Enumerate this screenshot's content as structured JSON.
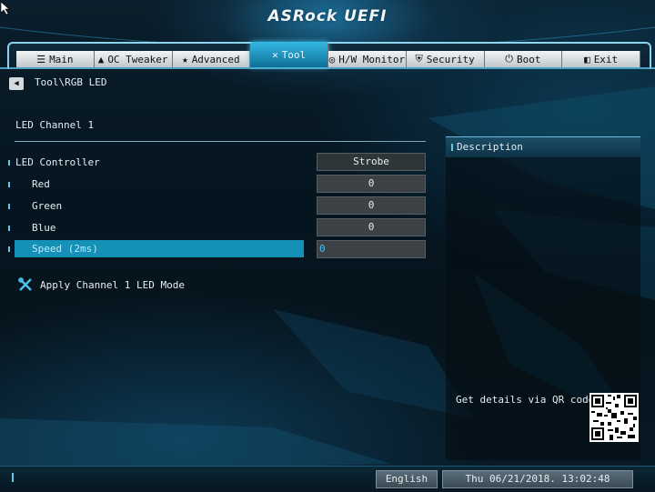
{
  "app": {
    "logo": "ASRock UEFI"
  },
  "tabs": [
    {
      "label": "Main",
      "icon": "list-icon",
      "glyph": "☰"
    },
    {
      "label": "OC Tweaker",
      "icon": "rocket-icon",
      "glyph": "▲"
    },
    {
      "label": "Advanced",
      "icon": "star-icon",
      "glyph": "★"
    },
    {
      "label": "Tool",
      "icon": "tools-icon",
      "glyph": "✕",
      "active": true
    },
    {
      "label": "H/W Monitor",
      "icon": "monitor-icon",
      "glyph": "◎"
    },
    {
      "label": "Security",
      "icon": "shield-icon",
      "glyph": "⛨"
    },
    {
      "label": "Boot",
      "icon": "power-icon",
      "glyph": "⏻"
    },
    {
      "label": "Exit",
      "icon": "exit-icon",
      "glyph": "◧"
    }
  ],
  "breadcrumb": "Tool\\RGB LED",
  "section_title": "LED Channel 1",
  "settings": {
    "controller": {
      "label": "LED Controller",
      "value": "Strobe"
    },
    "red": {
      "label": "Red",
      "value": "0"
    },
    "green": {
      "label": "Green",
      "value": "0"
    },
    "blue": {
      "label": "Blue",
      "value": "0"
    },
    "speed": {
      "label": "Speed (2ms)",
      "value": "0"
    }
  },
  "apply": {
    "label": "Apply Channel 1 LED Mode"
  },
  "description": {
    "title": "Description",
    "qr_text": "Get details via QR code"
  },
  "footer": {
    "language": "English",
    "datetime": "Thu 06/21/2018. 13:02:48"
  },
  "colors": {
    "accent": "#1590b7",
    "tab_active": "#35b8e4"
  }
}
